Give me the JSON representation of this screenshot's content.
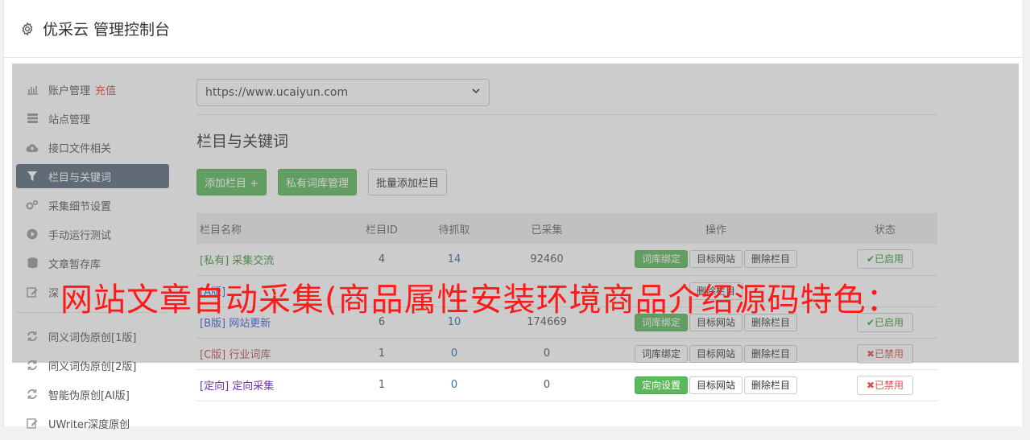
{
  "header": {
    "title": "优采云 管理控制台",
    "icon": "gear-icon"
  },
  "sidebar": {
    "items": [
      {
        "label": "账户管理",
        "extra": "充值",
        "icon": "bar-chart-icon"
      },
      {
        "label": "站点管理",
        "icon": "server-icon"
      },
      {
        "label": "接口文件相关",
        "icon": "cloud-upload-icon"
      },
      {
        "label": "栏目与关键词",
        "icon": "filter-icon",
        "active": true
      },
      {
        "label": "采集细节设置",
        "icon": "cogs-icon"
      },
      {
        "label": "手动运行测试",
        "icon": "play-icon"
      },
      {
        "label": "文章暂存库",
        "icon": "database-icon"
      },
      {
        "label": "深",
        "icon": "edit-icon"
      },
      {
        "label": "同义词伪原创[1版]",
        "icon": "refresh-icon"
      },
      {
        "label": "同义词伪原创[2版]",
        "icon": "refresh-icon"
      },
      {
        "label": "智能伪原创[AI版]",
        "icon": "refresh-icon"
      },
      {
        "label": "UWriter深度原创",
        "icon": "edit-icon"
      }
    ]
  },
  "main": {
    "site_select": "https://www.ucaiyun.com",
    "section_title": "栏目与关键词",
    "buttons": {
      "add": "添加栏目 +",
      "private": "私有词库管理",
      "batch": "批量添加栏目"
    },
    "table": {
      "headers": [
        "栏目名称",
        "栏目ID",
        "待抓取",
        "已采集",
        "操作",
        "状态"
      ],
      "rows": [
        {
          "tag": "[私有]",
          "name": "采集交流",
          "id": "4",
          "wait": "14",
          "done": "92460",
          "op1": "词库绑定",
          "op2": "目标网站",
          "op3": "删除栏目",
          "state": "✔已启用",
          "tagclass": "tag-priv",
          "op1green": true,
          "on": true
        },
        {
          "tag": "[A版]",
          "name": "",
          "id": "",
          "wait": "",
          "done": "",
          "op1": "",
          "op2": "",
          "op3": "删除栏目",
          "state": "",
          "tagclass": "tag-b",
          "op1green": true,
          "on": true
        },
        {
          "tag": "[B版]",
          "name": "网站更新",
          "id": "6",
          "wait": "10",
          "done": "174669",
          "op1": "词库绑定",
          "op2": "目标网站",
          "op3": "删除栏目",
          "state": "✔已启用",
          "tagclass": "tag-b",
          "op1green": true,
          "on": true
        },
        {
          "tag": "[C版]",
          "name": "行业词库",
          "id": "1",
          "wait": "0",
          "done": "0",
          "op1": "词库绑定",
          "op2": "目标网站",
          "op3": "删除栏目",
          "state": "✖已禁用",
          "tagclass": "tag-c",
          "op1green": false,
          "on": false
        },
        {
          "tag": "[定向]",
          "name": "定向采集",
          "id": "1",
          "wait": "0",
          "done": "0",
          "op1": "定向设置",
          "op2": "目标网站",
          "op3": "删除栏目",
          "state": "✖已禁用",
          "tagclass": "tag-dir",
          "op1green": true,
          "on": false
        }
      ]
    }
  },
  "overlay_text": "网站文章自动采集(商品属性安装环境商品介绍源码特色：",
  "colors": {
    "green": "#5cb85c",
    "overlay_red": "#ff1a1a",
    "active_nav": "#5b6b7c"
  }
}
